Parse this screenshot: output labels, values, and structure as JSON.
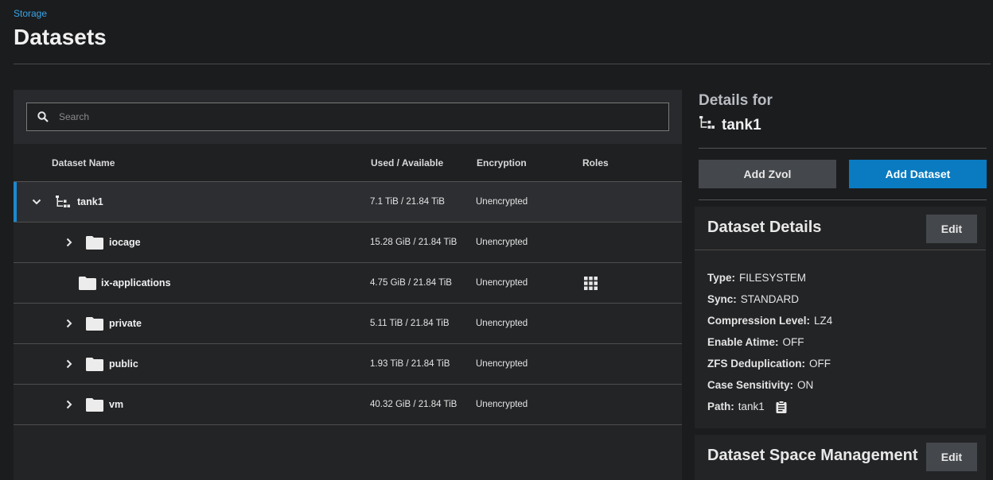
{
  "breadcrumb": "Storage",
  "title": "Datasets",
  "search": {
    "placeholder": "Search",
    "icon": "search-icon"
  },
  "columns": {
    "name": "Dataset Name",
    "used": "Used / Available",
    "encryption": "Encryption",
    "roles": "Roles"
  },
  "rows": [
    {
      "name": "tank1",
      "used": "7.1 TiB / 21.84 TiB",
      "encryption": "Unencrypted",
      "icon": "pool-tree-icon",
      "expander": "chevron-down-icon"
    },
    {
      "name": "iocage",
      "used": "15.28 GiB / 21.84 TiB",
      "encryption": "Unencrypted",
      "icon": "folder-icon",
      "expander": "chevron-right-icon"
    },
    {
      "name": "ix-applications",
      "used": "4.75 GiB / 21.84 TiB",
      "encryption": "Unencrypted",
      "icon": "folder-icon",
      "role_icon": "apps-grid-icon"
    },
    {
      "name": "private",
      "used": "5.11 TiB / 21.84 TiB",
      "encryption": "Unencrypted",
      "icon": "folder-icon",
      "expander": "chevron-right-icon"
    },
    {
      "name": "public",
      "used": "1.93 TiB / 21.84 TiB",
      "encryption": "Unencrypted",
      "icon": "folder-icon",
      "expander": "chevron-right-icon"
    },
    {
      "name": "vm",
      "used": "40.32 GiB / 21.84 TiB",
      "encryption": "Unencrypted",
      "icon": "folder-icon",
      "expander": "chevron-right-icon"
    }
  ],
  "details": {
    "heading": "Details for",
    "name": "tank1",
    "add_zvol": "Add Zvol",
    "add_dataset": "Add Dataset"
  },
  "dataset_details": {
    "title": "Dataset Details",
    "edit": "Edit",
    "props": [
      {
        "key": "Type:",
        "value": "FILESYSTEM"
      },
      {
        "key": "Sync:",
        "value": "STANDARD"
      },
      {
        "key": "Compression Level:",
        "value": "LZ4"
      },
      {
        "key": "Enable Atime:",
        "value": "OFF"
      },
      {
        "key": "ZFS Deduplication:",
        "value": "OFF"
      },
      {
        "key": "Case Sensitivity:",
        "value": "ON"
      },
      {
        "key": "Path:",
        "value": "tank1"
      }
    ]
  },
  "space_management": {
    "title": "Dataset Space Management",
    "edit": "Edit"
  },
  "colors": {
    "accent": "#0a7bc0",
    "link": "#3aa6e8",
    "selected_bar": "#1a8ad0"
  }
}
